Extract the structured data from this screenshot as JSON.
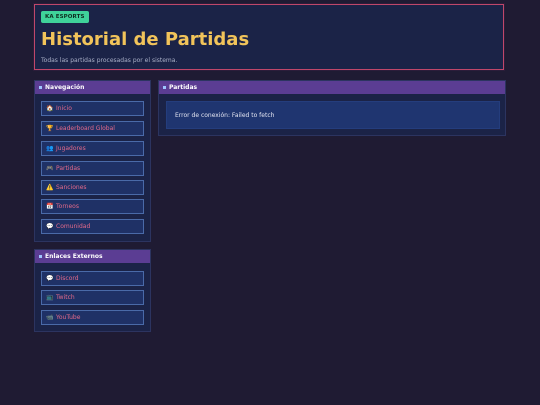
{
  "header": {
    "badge": "KA ESPORTS",
    "title": "Historial de Partidas",
    "subtitle": "Todas las partidas procesadas por el sistema."
  },
  "nav_panel": {
    "title": "Navegación",
    "items": [
      {
        "icon": "🏠",
        "icon_name": "home-icon",
        "label": "Inicio"
      },
      {
        "icon": "🏆",
        "icon_name": "trophy-icon",
        "label": "Leaderboard Global"
      },
      {
        "icon": "👥",
        "icon_name": "users-icon",
        "label": "Jugadores"
      },
      {
        "icon": "🎮",
        "icon_name": "gamepad-icon",
        "label": "Partidas"
      },
      {
        "icon": "⚠️",
        "icon_name": "warning-icon",
        "label": "Sanciones"
      },
      {
        "icon": "📅",
        "icon_name": "calendar-icon",
        "label": "Torneos"
      },
      {
        "icon": "💬",
        "icon_name": "chat-icon",
        "label": "Comunidad"
      }
    ]
  },
  "links_panel": {
    "title": "Enlaces Externos",
    "items": [
      {
        "icon": "💬",
        "icon_name": "discord-icon",
        "label": "Discord"
      },
      {
        "icon": "📺",
        "icon_name": "twitch-icon",
        "label": "Twitch"
      },
      {
        "icon": "📹",
        "icon_name": "youtube-icon",
        "label": "YouTube"
      }
    ]
  },
  "matches_panel": {
    "title": "Partidas",
    "error": "Error de conexión: Failed to fetch"
  },
  "colors": {
    "background": "#1f1b33",
    "panel": "#1b2347",
    "panel_header": "#5b3d93",
    "accent_title": "#f2c45a",
    "badge": "#3fd29a",
    "link": "#e46a8a",
    "header_border": "#c0476a"
  }
}
